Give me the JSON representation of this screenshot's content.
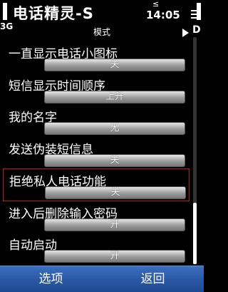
{
  "status": {
    "app_title": "电话精灵-S",
    "network": "3G",
    "time": "14:05",
    "usb": "≤"
  },
  "header": {
    "mode_label": "模式",
    "right_letter": "D"
  },
  "settings": [
    {
      "label": "一直显示电话小图标",
      "value": "关"
    },
    {
      "label": "短信显示时间顺序",
      "value": "上升"
    },
    {
      "label": "我的名字",
      "value": "无"
    },
    {
      "label": "发送伪装短信息",
      "value": "关"
    },
    {
      "label": "拒绝私人电话功能",
      "value": "关"
    },
    {
      "label": "进入后删除输入密码",
      "value": "开"
    },
    {
      "label": "自动启动",
      "value": "开"
    }
  ],
  "softkeys": {
    "left": "选项",
    "right": "返回"
  },
  "colors": {
    "background": "#000000",
    "highlight_border": "#c01818",
    "softkey_bar": "#2b59a6"
  }
}
